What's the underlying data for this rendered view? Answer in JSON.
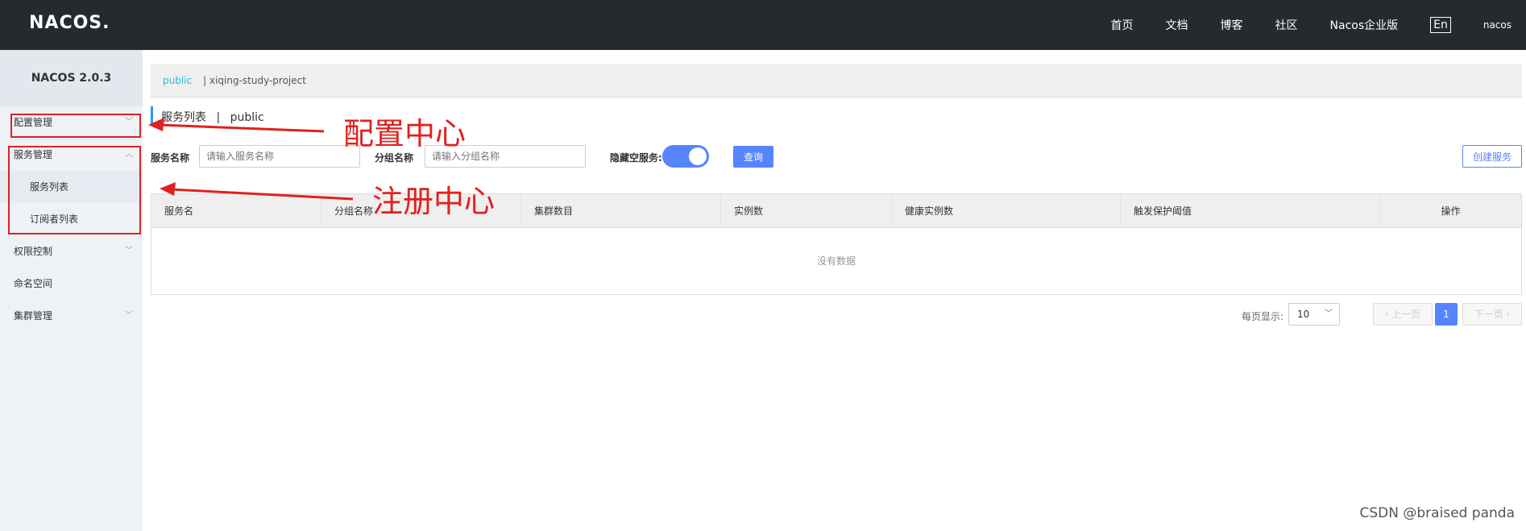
{
  "header": {
    "logo": "NACOS.",
    "nav": [
      "首页",
      "文档",
      "博客",
      "社区",
      "Nacos企业版"
    ],
    "lang": "En",
    "user": "nacos"
  },
  "sidebar": {
    "title": "NACOS 2.0.3",
    "items": [
      {
        "label": "配置管理"
      },
      {
        "label": "服务管理"
      },
      {
        "label": "服务列表"
      },
      {
        "label": "订阅者列表"
      },
      {
        "label": "权限控制"
      },
      {
        "label": "命名空间"
      },
      {
        "label": "集群管理"
      }
    ]
  },
  "namespaces": {
    "active": "public",
    "other": "| xiqing-study-project"
  },
  "page": {
    "title": "服务列表",
    "sep": "|",
    "namespace": "public"
  },
  "search": {
    "service_label": "服务名称",
    "service_placeholder": "请输入服务名称",
    "group_label": "分组名称",
    "group_placeholder": "请输入分组名称",
    "hide_empty_label": "隐藏空服务:",
    "hide_empty_on": true,
    "query_label": "查询",
    "create_label": "创建服务"
  },
  "table": {
    "headers": [
      "服务名",
      "分组名称",
      "集群数目",
      "实例数",
      "健康实例数",
      "触发保护阈值",
      "操作"
    ],
    "empty": "没有数据"
  },
  "pager": {
    "per_page_label": "每页显示:",
    "per_page": "10",
    "prev": "上一页",
    "current": "1",
    "next": "下一页"
  },
  "annotations": {
    "config_center": "配置中心",
    "registry_center": "注册中心",
    "color": "#e1201f"
  },
  "watermark": "CSDN @braised panda"
}
